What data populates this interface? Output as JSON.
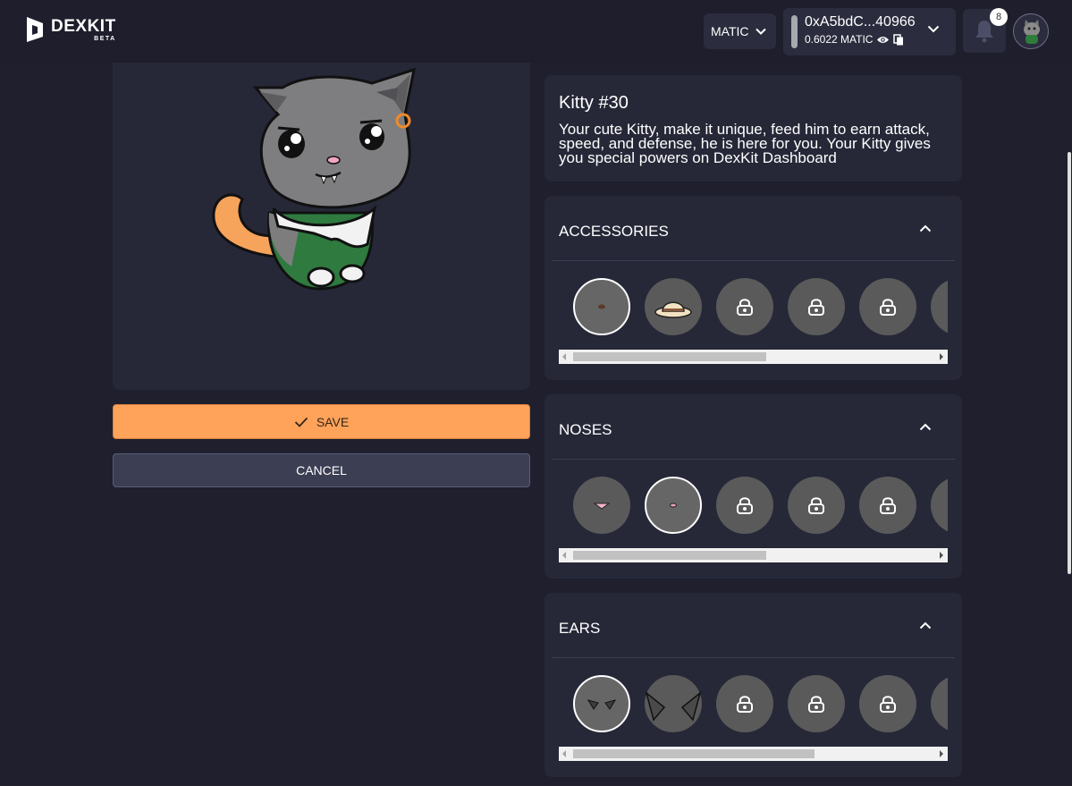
{
  "header": {
    "logo_name": "DEXKIT",
    "logo_tag": "BETA",
    "network": "MATIC",
    "wallet_address": "0xA5bdC...40966",
    "wallet_balance": "0.6022 MATIC",
    "notification_count": "8"
  },
  "actions": {
    "save_label": "SAVE",
    "cancel_label": "CANCEL"
  },
  "kitty": {
    "title": "Kitty #30",
    "description": "Your cute Kitty, make it unique, feed him to earn attack, speed, and defense, he is here for you. Your Kitty gives you special powers on DexKit Dashboard"
  },
  "sections": {
    "accessories": {
      "title": "ACCESSORIES",
      "scroll_fraction": 0.53
    },
    "noses": {
      "title": "NOSES",
      "scroll_fraction": 0.53
    },
    "ears": {
      "title": "EARS",
      "scroll_fraction": 0.67
    }
  },
  "colors": {
    "accent": "#ffa25a",
    "card_bg": "#262838",
    "page_bg": "#1f1f2e",
    "button_bg": "#3c3e54"
  },
  "icons": [
    "dexkit-logo-icon",
    "chevron-down-icon",
    "eye-icon",
    "copy-icon",
    "bell-icon",
    "check-icon",
    "chevron-up-icon",
    "lock-icon"
  ]
}
